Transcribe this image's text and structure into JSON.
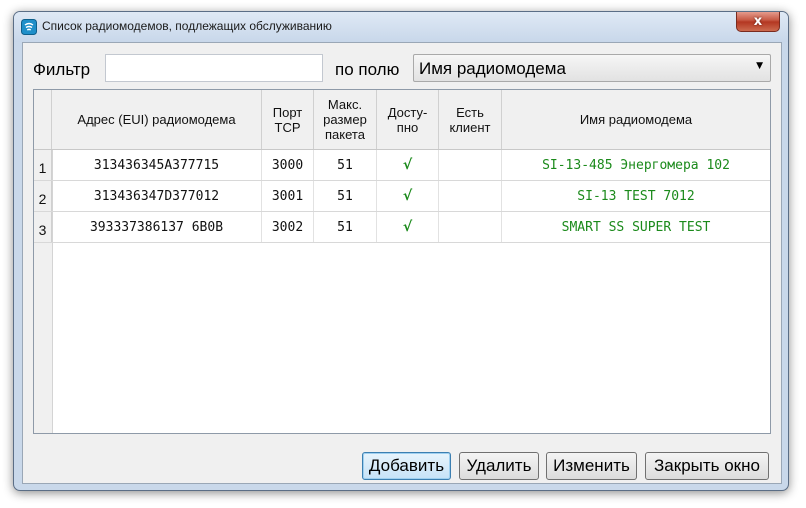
{
  "window": {
    "title": "Список радиомодемов, подлежащих обслуживанию",
    "close_glyph": "x"
  },
  "filter": {
    "label": "Фильтр",
    "value": "",
    "field_label": "по полю",
    "field_selected": "Имя радиомодема"
  },
  "table": {
    "columns": [
      "Адрес (EUI) радиомодема",
      "Порт TCP",
      "Макс. размер пакета",
      "Досту-пно",
      "Есть клиент",
      "Имя радиомодема"
    ],
    "rows": [
      {
        "num": "1",
        "eui": "313436345A377715",
        "port": "3000",
        "size": "51",
        "avail": "√",
        "client": "",
        "name": "SI-13-485 Энергомера 102"
      },
      {
        "num": "2",
        "eui": "313436347D377012",
        "port": "3001",
        "size": "51",
        "avail": "√",
        "client": "",
        "name": "SI-13 TEST 7012"
      },
      {
        "num": "3",
        "eui": "393337386137 6B0B",
        "port": "3002",
        "size": "51",
        "avail": "√",
        "client": "",
        "name": "SMART SS SUPER TEST"
      }
    ]
  },
  "buttons": {
    "add": "Добавить",
    "delete": "Удалить",
    "edit": "Изменить",
    "close": "Закрыть окно"
  },
  "colors": {
    "name_text": "#1b8a1b",
    "check": "#1b8a1b",
    "close_button": "#c75a45"
  }
}
